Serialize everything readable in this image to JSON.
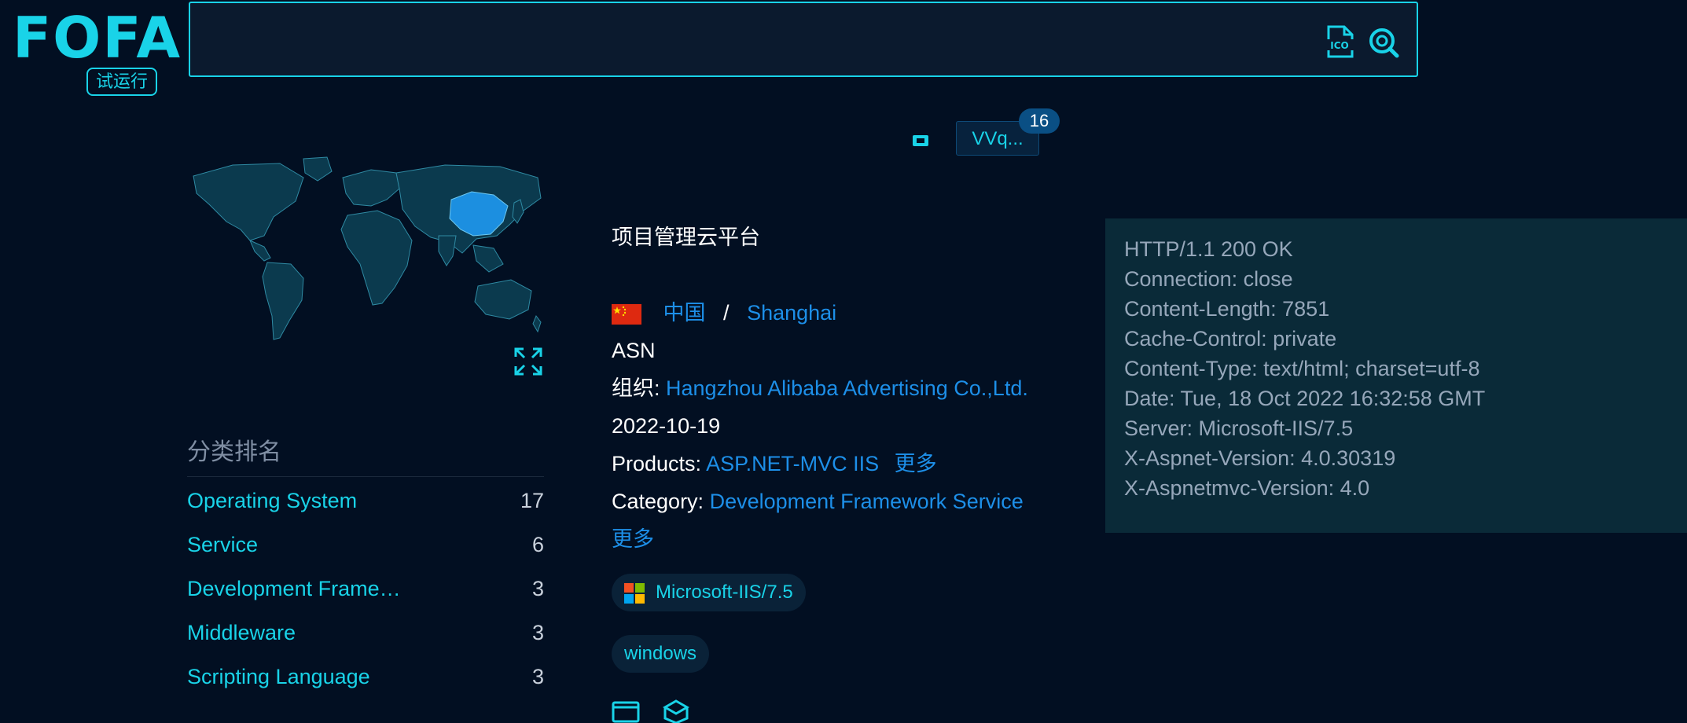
{
  "logo": {
    "text": "FOFA",
    "badge": "试运行"
  },
  "search": {
    "query": ""
  },
  "host": {
    "title": "",
    "cert_label": "VVq...",
    "cert_count": "16",
    "site_title_suffix": "项目管理云平台",
    "country": "中国",
    "city": "Shanghai",
    "asn_label": "ASN",
    "org_label": "组织:",
    "org_value": "Hangzhou Alibaba Advertising Co.,Ltd.",
    "date": "2022-10-19",
    "products_label": "Products:",
    "products_value": "ASP.NET-MVC IIS",
    "products_more": "更多",
    "category_label": "Category:",
    "category_value": "Development Framework Service",
    "category_more": "更多",
    "chips": [
      "Microsoft-IIS/7.5",
      "windows"
    ]
  },
  "ranking": {
    "title": "分类排名",
    "items": [
      {
        "label": "Operating System",
        "count": "17"
      },
      {
        "label": "Service",
        "count": "6"
      },
      {
        "label": "Development Frame…",
        "count": "3"
      },
      {
        "label": "Middleware",
        "count": "3"
      },
      {
        "label": "Scripting Language",
        "count": "3"
      }
    ]
  },
  "headers": [
    "HTTP/1.1 200 OK",
    "Connection: close",
    "Content-Length: 7851",
    "Cache-Control: private",
    "Content-Type: text/html; charset=utf-8",
    "Date: Tue, 18 Oct 2022 16:32:58 GMT",
    "Server: Microsoft-IIS/7.5",
    "X-Aspnet-Version: 4.0.30319",
    "X-Aspnetmvc-Version: 4.0"
  ],
  "colors": {
    "accent": "#19d3e8",
    "link": "#1d8fe8",
    "background": "#020f22"
  },
  "icons": [
    "ico-file-icon",
    "search-go-icon",
    "expand-icon",
    "tag-icon",
    "windows-logo-icon",
    "code-icon",
    "cube-icon"
  ]
}
